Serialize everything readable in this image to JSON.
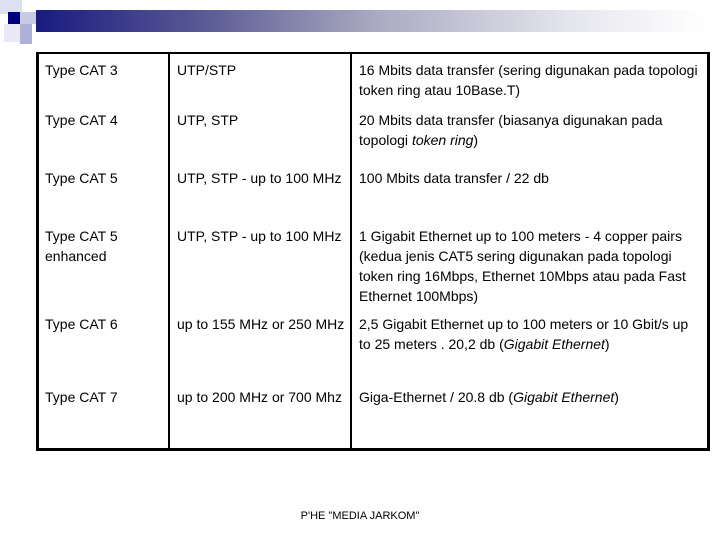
{
  "rows": [
    {
      "type": "Type CAT 3",
      "media": "UTP/STP",
      "desc": "16 Mbits data transfer (sering digunakan pada topologi token ring atau 10Base.T)"
    },
    {
      "type": "Type CAT 4",
      "media": "UTP, STP",
      "desc_html": "20 Mbits data transfer (biasanya digunakan pada topologi <i>token ring</i>)"
    },
    {
      "type": "Type CAT 5",
      "media": "UTP, STP - up to  100 MHz",
      "desc": "100 Mbits data transfer / 22 db"
    },
    {
      "type": "Type CAT 5 enhanced",
      "media": "UTP, STP - up to 100 MHz",
      "desc": "1 Gigabit Ethernet up to 100 meters - 4 copper pairs (kedua jenis CAT5 sering digunakan pada topologi token ring 16Mbps, Ethernet 10Mbps atau pada Fast Ethernet 100Mbps)"
    },
    {
      "type": "Type CAT 6",
      "media": "up to 155 MHz or 250 MHz",
      "desc_html": "2,5 Gigabit Ethernet up to 100 meters or 10 Gbit/s up to 25 meters . 20,2 db (<i>Gigabit Ethernet</i>)"
    },
    {
      "type": "Type CAT 7",
      "media": "up to 200 MHz or 700 Mhz",
      "desc_html": "Giga-Ethernet / 20.8 db (<i>Gigabit Ethernet</i>)"
    }
  ],
  "footer": "P'HE \"MEDIA JARKOM\"",
  "colors": {
    "accent": "#1a1a80"
  }
}
